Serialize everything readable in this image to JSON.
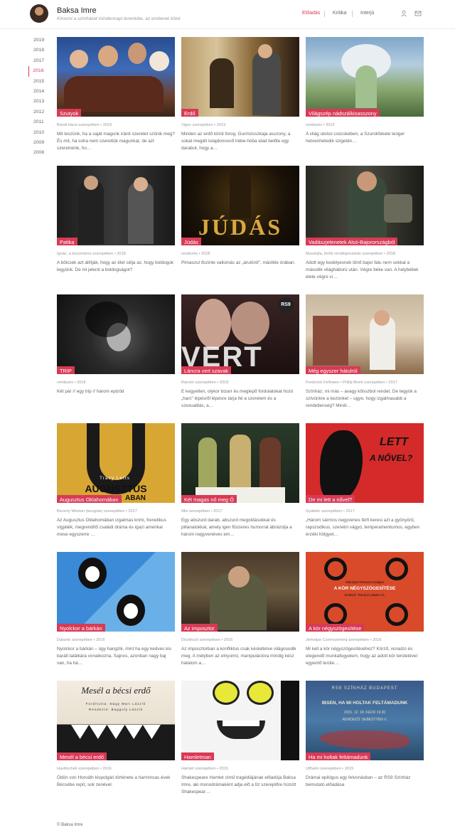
{
  "header": {
    "title": "Baksa Imre",
    "tagline": "Kínozni a színházat mindennapi terenkibe, az emberek közé",
    "nav": [
      "Előadás",
      "Kritika",
      "Interjú"
    ],
    "active_nav": "Előadás",
    "icons": [
      "user-icon",
      "mail-icon"
    ]
  },
  "years": [
    "2019",
    "2018",
    "2017",
    "2016",
    "2015",
    "2014",
    "2013",
    "2012",
    "2011",
    "2010",
    "2009",
    "2008"
  ],
  "active_year": "2016",
  "accent": "#d83a55",
  "cards": [
    {
      "title": "Szutyok",
      "meta": "Bandi bácsi szerepében • 2019",
      "excerpt": "Mit teszünk, ha a saját magunk iránti szeretet szűnik meg? És mit, ha soha nem szerettük magunkat, de azt szeretnénk, ho…"
    },
    {
      "title": "Erdő",
      "meta": "Vigov szerepében • 2019",
      "excerpt": "Minden az erdő körül forog. Gurmizsszkaja asszony, a sokat megélt tulajdonosnő hébe-hóba elad belőle egy darabot, hogy a…"
    },
    {
      "title": "Világszép nádszálkisasszony",
      "meta": "rendezés • 2019",
      "excerpt": "A világ utolsó csücskében, a Szurokfekete tenger hetvenhetedik szigetén…"
    },
    {
      "title": "Patika",
      "meta": "Ignác, a kocsmáros szerepében • 2018",
      "excerpt": "A bölcsek azt állítják, hogy az élet célja az, hogy boldogok legyünk. De mi jelenti a boldogságot?"
    },
    {
      "title": "Júdás",
      "meta": "rendezés • 2018",
      "excerpt": "Pimaszul őszinte vallomás az „árulóról\", másféle órában."
    },
    {
      "title": "Vadászjelenetek Alsó-Bajorországból",
      "meta": "Musztafa, török vendégmunkás szerepében • 2018",
      "excerpt": "Adott egy kedélyesnek tűnő bajor falu nem sokkal a második világháború után. Végre béke van. A helybéliek élete végre vi…"
    },
    {
      "title": "TRIP",
      "meta": "rendezés • 2018",
      "excerpt": "Két pár // egy trip // három epizód"
    },
    {
      "title": "Láncra vert szavak",
      "meta": "Ramón szerepében • 2018",
      "excerpt": "E kegyetlen, olykor bizarr és meglepő fordulatokat hozó „harc\" lépésről lépésre tárja fel a szerelem és a szexualitás, a…"
    },
    {
      "title": "Még egyszer hátulról",
      "meta": "Frederick Fellowes • Philip Brent szerepében • 2017",
      "excerpt": "Színház, mi más – avagy kőoszbol rendet. De tegyük a szívünkre a kezünket – ugye, hogy izgalmasabb a rendetlenség? Minél…"
    },
    {
      "title": "Augusztus Oklahomában",
      "meta": "Beverly Weston (beugrás) szerepében • 2017",
      "excerpt": "Az Augusztus Oklahomában izgalmas krimi, frenetikus vígjáték, megrendítő családi dráma és igazi amerikai mese egyszerre …"
    },
    {
      "title": "Két magas nő meg Ő",
      "meta": "Nils szerepében • 2017",
      "excerpt": "Egy abszurd darab, abszurd megoldásokkal és pillanatokkal, amely igen fűszeres humorral ábrázolja a három negyvenéves em…"
    },
    {
      "title": "De mi lett a nővel?",
      "meta": "Gyabkin szerepében • 2017",
      "excerpt": "„Három sármos negyvenes férfi keresi azt a gyönyörű, rapszodikus, szeretni vágyó, temperamentumos, egyben érzéki hölgyet…"
    },
    {
      "title": "Nyolckor a bárkán",
      "meta": "Dalamb szerepében • 2016",
      "excerpt": "Nyolckor a bárkán – ügy hangzik, mint ha egy kedves kis baráti találkára vonatkozna. Sajnos, azonban nagy baj van, ha há…"
    },
    {
      "title": "Az imposztor",
      "meta": "Diszlésző szerepében • 2016",
      "excerpt": "Az imposztorban a konfliktus csak késleltetve világosodik meg. A mélyben az elnyomó, manipulációra mindig kész hatalom a…"
    },
    {
      "title": "A kör négyszögesítése",
      "meta": "Jemeljan Csernozemnij szerepében • 2016",
      "excerpt": "Mi kell a kör négyszögesítéséhez? Körző, vonalzó és elegendő munkafegyelem, hogy az adott kör területével egyenlő terüle…"
    },
    {
      "title": "Mesél a bécsi erdő",
      "meta": "Havlitschek szerepében • 2016",
      "excerpt": "Ödön von Horváth kispolgári története a harmincas évek Bécsébe repít, sok zenével."
    },
    {
      "title": "Hamletman",
      "meta": "Hamlet szerepében • 2015",
      "excerpt": "Shakespeare Hamlet című tragédiájának előadója Baksa Imre, aki monodrámaként adja elő a tíz szereplőre húzott Shakespear…"
    },
    {
      "title": "Ha mi holtak feltámadunk",
      "meta": "Ulfheim szerepében • 2015",
      "excerpt": "Drámai epilógus egy felvonásban – az RS9 Színház bemutató előadása"
    }
  ],
  "poster_text": {
    "rs9": "RS9",
    "judas": "JÚDÁS",
    "vert": "VERT",
    "tracy_letts": "Tracy Letts",
    "augusztus": "AUGUSZTUS",
    "oklahoma_fragment": "ABAN",
    "de_mi_lett": "LETT",
    "novel": "A NŐVEL?",
    "kor_author": "Valentyin Petrovics Katajev",
    "kor_title": "A KÖR NÉGYSZÖGESÍTÉSE",
    "kor_director": "rendező: Tarnóczi Jakab e.h.",
    "mesel_title": "Mesél a bécsi erdő",
    "mesel_translator": "Fordította: Nagy Mari László",
    "mesel_director": "Rendezte: Baggoly László",
    "ibsen_theatre": "RS9 SZÍNHÁZ BUDAPEST",
    "ibsen_title": "IBSEN, HA MI HOLTAK FELTÁMADUNK",
    "ibsen_date": "2015. 12. 18. KEDD 19.30",
    "ibsen_director": "RENDEZŐ: SEBESTYÉN V."
  },
  "footer": "© Baksa Imre"
}
